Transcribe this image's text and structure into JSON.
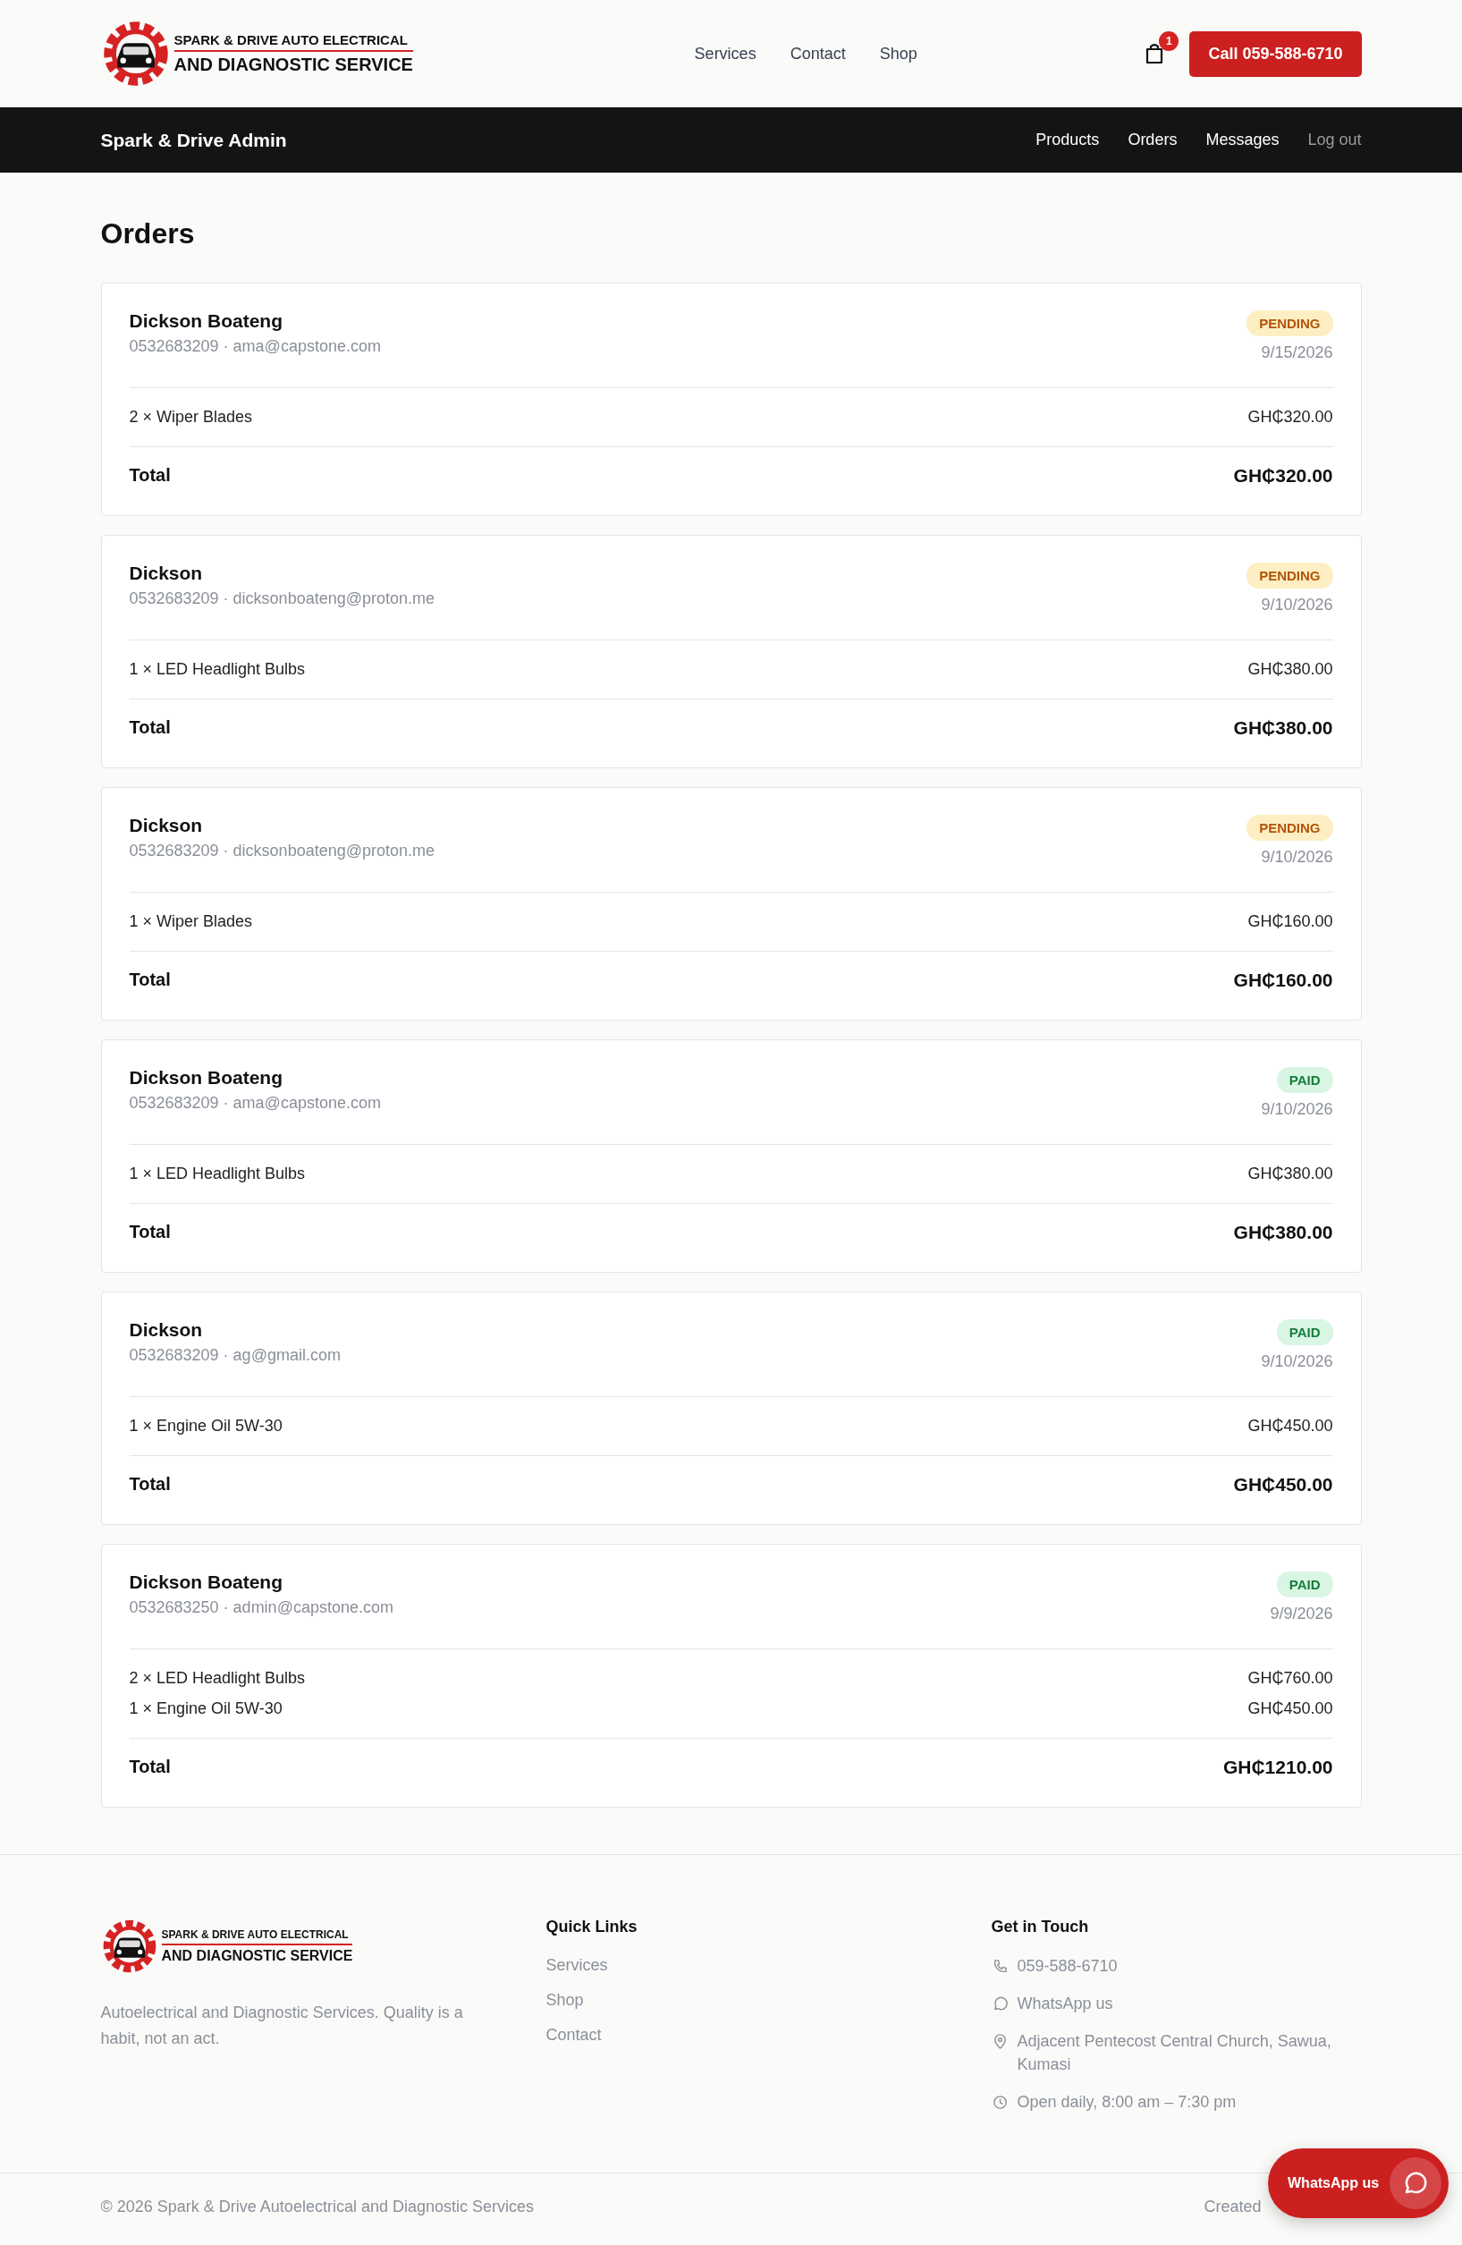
{
  "header": {
    "logo": {
      "line_1": "SPARK & DRIVE AUTO ELECTRICAL",
      "line_2": "AND DIAGNOSTIC SERVICE"
    },
    "nav": [
      "Services",
      "Contact",
      "Shop"
    ],
    "cart_count": "1",
    "call_button": "Call 059-588-6710"
  },
  "admin_bar": {
    "title": "Spark & Drive Admin",
    "links": [
      {
        "label": "Products",
        "muted": false
      },
      {
        "label": "Orders",
        "muted": false
      },
      {
        "label": "Messages",
        "muted": false
      },
      {
        "label": "Log out",
        "muted": true
      }
    ]
  },
  "page_title": "Orders",
  "orders": [
    {
      "name": "Dickson Boateng",
      "contact": "0532683209 · ama@capstone.com",
      "status": {
        "label": "PENDING",
        "kind": "pending"
      },
      "date": "9/15/2026",
      "items": [
        {
          "text": "2 × Wiper Blades",
          "price": "GH₵320.00"
        }
      ],
      "total_label": "Total",
      "total": "GH₵320.00"
    },
    {
      "name": "Dickson",
      "contact": "0532683209 · dicksonboateng@proton.me",
      "status": {
        "label": "PENDING",
        "kind": "pending"
      },
      "date": "9/10/2026",
      "items": [
        {
          "text": "1 × LED Headlight Bulbs",
          "price": "GH₵380.00"
        }
      ],
      "total_label": "Total",
      "total": "GH₵380.00"
    },
    {
      "name": "Dickson",
      "contact": "0532683209 · dicksonboateng@proton.me",
      "status": {
        "label": "PENDING",
        "kind": "pending"
      },
      "date": "9/10/2026",
      "items": [
        {
          "text": "1 × Wiper Blades",
          "price": "GH₵160.00"
        }
      ],
      "total_label": "Total",
      "total": "GH₵160.00"
    },
    {
      "name": "Dickson Boateng",
      "contact": "0532683209 · ama@capstone.com",
      "status": {
        "label": "PAID",
        "kind": "paid"
      },
      "date": "9/10/2026",
      "items": [
        {
          "text": "1 × LED Headlight Bulbs",
          "price": "GH₵380.00"
        }
      ],
      "total_label": "Total",
      "total": "GH₵380.00"
    },
    {
      "name": "Dickson",
      "contact": "0532683209 · ag@gmail.com",
      "status": {
        "label": "PAID",
        "kind": "paid"
      },
      "date": "9/10/2026",
      "items": [
        {
          "text": "1 × Engine Oil 5W-30",
          "price": "GH₵450.00"
        }
      ],
      "total_label": "Total",
      "total": "GH₵450.00"
    },
    {
      "name": "Dickson Boateng",
      "contact": "0532683250 · admin@capstone.com",
      "status": {
        "label": "PAID",
        "kind": "paid"
      },
      "date": "9/9/2026",
      "items": [
        {
          "text": "2 × LED Headlight Bulbs",
          "price": "GH₵760.00"
        },
        {
          "text": "1 × Engine Oil 5W-30",
          "price": "GH₵450.00"
        }
      ],
      "total_label": "Total",
      "total": "GH₵1210.00"
    }
  ],
  "footer": {
    "logo": {
      "line_1": "SPARK & DRIVE AUTO ELECTRICAL",
      "line_2": "AND DIAGNOSTIC SERVICE"
    },
    "tagline": "Autoelectrical and Diagnostic Services. Quality is a habit, not an act.",
    "quick_links": {
      "heading": "Quick Links",
      "links": [
        "Services",
        "Shop",
        "Contact"
      ]
    },
    "contact": {
      "heading": "Get in Touch",
      "items": [
        {
          "kind": "phone",
          "text": "059-588-6710"
        },
        {
          "kind": "chat",
          "text": "WhatsApp us"
        },
        {
          "kind": "location",
          "text": "Adjacent Pentecost Central Church, Sawua, Kumasi"
        },
        {
          "kind": "hours",
          "text": "Open daily, 8:00 am – 7:30 pm"
        }
      ]
    },
    "copyright": "© 2026 Spark & Drive Autoelectrical and Diagnostic Services",
    "credit": "Created"
  },
  "whatsapp_button": "WhatsApp us"
}
